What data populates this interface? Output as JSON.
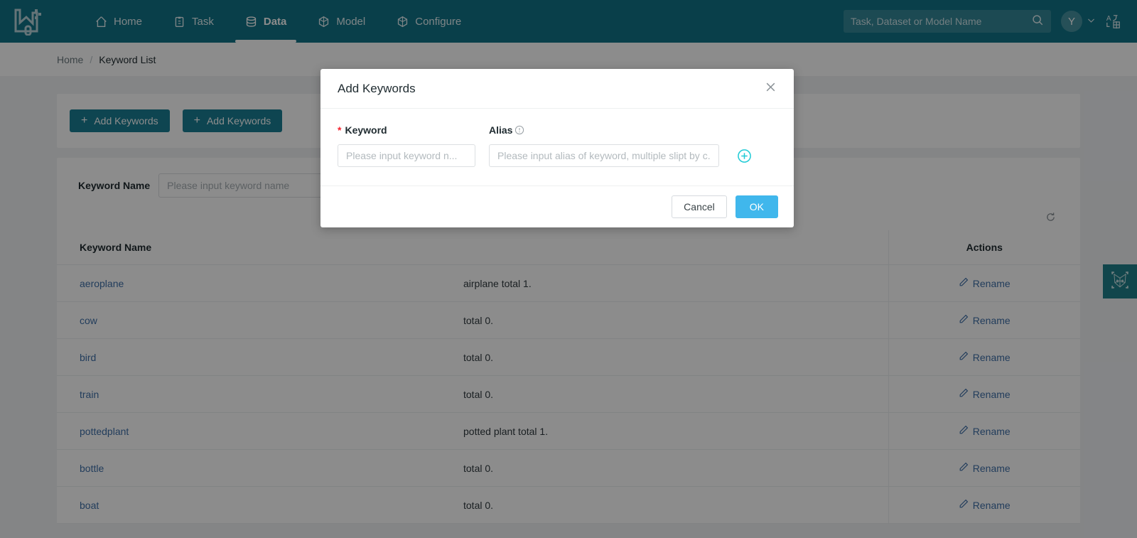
{
  "nav": {
    "logo_icon": "factory-logo-icon",
    "items": [
      {
        "label": "Home",
        "icon": "home-icon",
        "active": false
      },
      {
        "label": "Task",
        "icon": "clipboard-icon",
        "active": false
      },
      {
        "label": "Data",
        "icon": "database-icon",
        "active": true
      },
      {
        "label": "Model",
        "icon": "cube-icon",
        "active": false
      },
      {
        "label": "Configure",
        "icon": "cube-icon",
        "active": false
      }
    ],
    "search": {
      "placeholder": "Task, Dataset or Model Name",
      "value": "",
      "icon": "search-icon"
    },
    "avatar_initial": "Y",
    "chevron": "⌄",
    "language_icon": "language-toggle-icon"
  },
  "breadcrumb": {
    "home": "Home",
    "separator": "/",
    "current": "Keyword List"
  },
  "actions_card": {
    "buttons": [
      {
        "label": "Add Keywords",
        "icon": "plus-icon"
      },
      {
        "label": "Add Keywords",
        "icon": "plus-icon"
      }
    ]
  },
  "filter": {
    "label": "Keyword Name",
    "placeholder": "Please input keyword name",
    "value": ""
  },
  "table": {
    "refresh_icon": "refresh-icon",
    "columns": [
      "Keyword Name",
      "",
      "Actions"
    ],
    "action_label": "Rename",
    "action_icon": "pencil-icon",
    "rows": [
      {
        "keyword": "aeroplane",
        "description": "airplane total 1."
      },
      {
        "keyword": "cow",
        "description": "total 0."
      },
      {
        "keyword": "bird",
        "description": "total 0."
      },
      {
        "keyword": "train",
        "description": "total 0."
      },
      {
        "keyword": "pottedplant",
        "description": "potted plant total 1."
      },
      {
        "keyword": "bottle",
        "description": "total 0."
      },
      {
        "keyword": "boat",
        "description": "total 0."
      }
    ]
  },
  "side_widget": {
    "icon": "animal-face-detect-icon"
  },
  "modal": {
    "title": "Add Keywords",
    "close_icon": "close-icon",
    "keyword_label": "Keyword",
    "keyword_required_mark": "*",
    "keyword_placeholder": "Please input keyword n...",
    "keyword_value": "",
    "alias_label": "Alias",
    "alias_info_icon": "info-circle-icon",
    "alias_placeholder": "Please input alias of keyword, multiple slipt by c...",
    "alias_value": "",
    "add_row_icon": "plus-circle-icon",
    "cancel_label": "Cancel",
    "ok_label": "OK"
  },
  "colors": {
    "nav_background": "#127487",
    "primary_button": "#1b7f94",
    "ok_button": "#40b7ec",
    "link": "#3f6fa8",
    "required_star": "#f5222d",
    "accent_cyan": "#21cbd6",
    "side_widget": "#20808b"
  }
}
